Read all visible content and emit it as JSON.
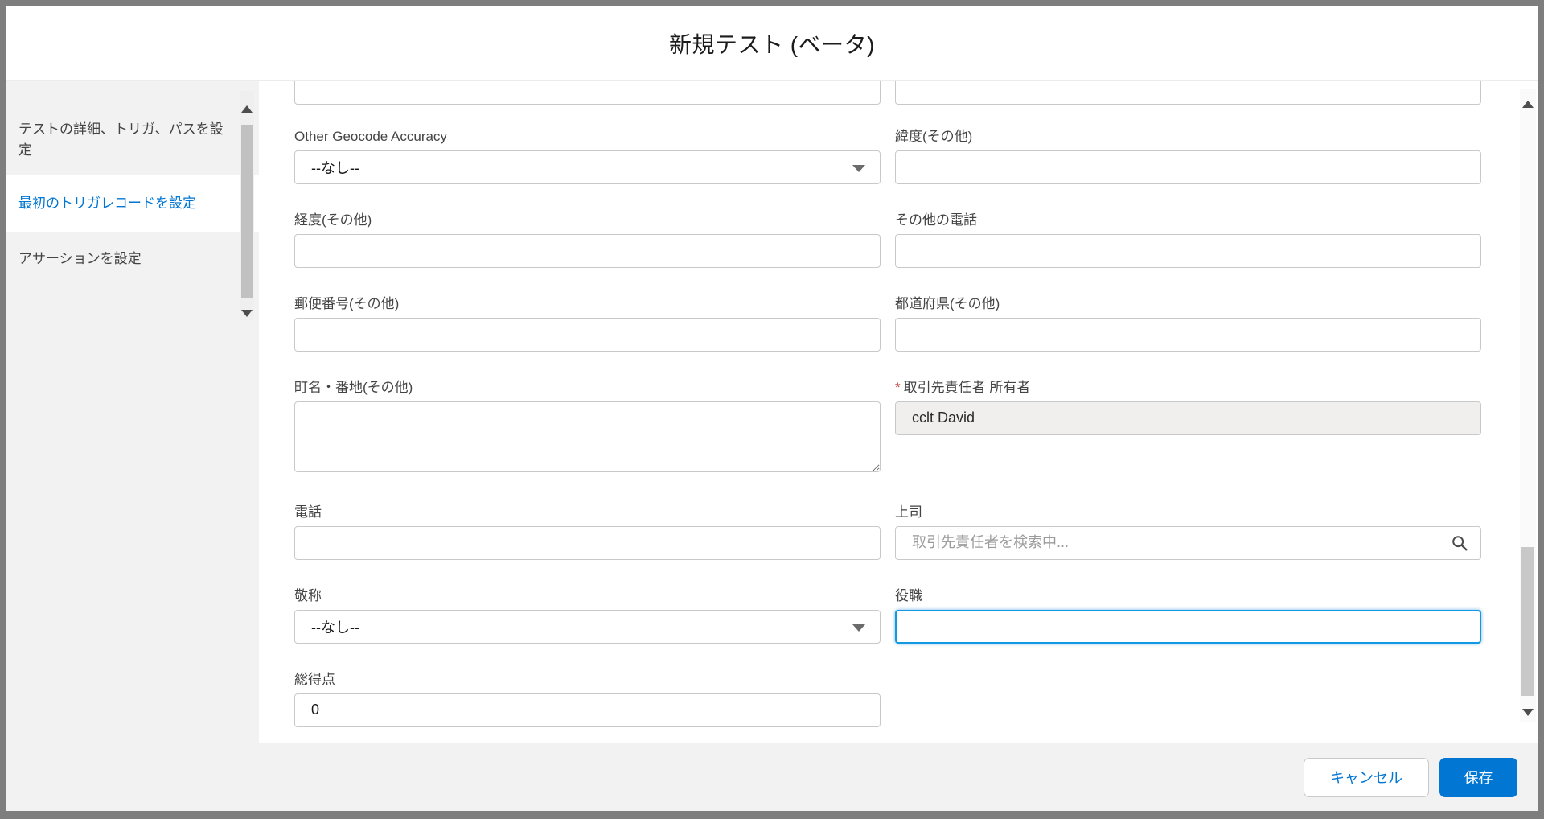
{
  "modal": {
    "title": "新規テスト (ベータ)"
  },
  "sidebar": {
    "items": [
      {
        "label": "テストの詳細、トリガ、パスを設定",
        "active": false
      },
      {
        "label": "最初のトリガレコードを設定",
        "active": true
      },
      {
        "label": "アサーションを設定",
        "active": false
      }
    ]
  },
  "form": {
    "fields": {
      "other_geocode_accuracy": {
        "label": "Other Geocode Accuracy",
        "value": "--なし--",
        "type": "picklist"
      },
      "latitude_other": {
        "label": "緯度(その他)",
        "value": ""
      },
      "longitude_other": {
        "label": "経度(その他)",
        "value": ""
      },
      "other_phone": {
        "label": "その他の電話",
        "value": ""
      },
      "postal_code_other": {
        "label": "郵便番号(その他)",
        "value": ""
      },
      "state_other": {
        "label": "都道府県(その他)",
        "value": ""
      },
      "street_other": {
        "label": "町名・番地(その他)",
        "value": ""
      },
      "contact_owner": {
        "label": "取引先責任者 所有者",
        "required_mark": "*",
        "value": "cclt David",
        "disabled": true
      },
      "phone": {
        "label": "電話",
        "value": ""
      },
      "reports_to": {
        "label": "上司",
        "value": "",
        "placeholder": "取引先責任者を検索中..."
      },
      "salutation": {
        "label": "敬称",
        "value": "--なし--",
        "type": "picklist"
      },
      "title": {
        "label": "役職",
        "value": "",
        "focused": true
      },
      "total_score": {
        "label": "総得点",
        "value": "0"
      }
    }
  },
  "footer": {
    "cancel_label": "キャンセル",
    "save_label": "保存"
  },
  "colors": {
    "brand_blue": "#0176d3",
    "required_red": "#c23934",
    "sidebar_gray": "#f2f2f2",
    "footer_gray": "#f3f2f2",
    "frame_gray": "#7e7e7e",
    "input_border": "#c9c9c9"
  }
}
